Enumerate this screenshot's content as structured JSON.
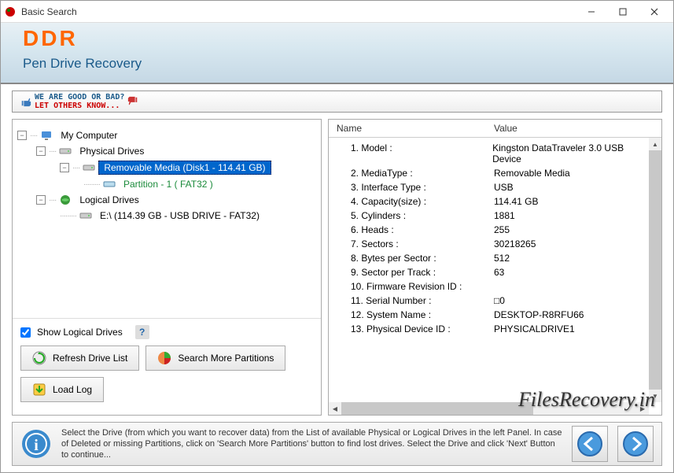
{
  "window": {
    "title": "Basic Search"
  },
  "header": {
    "logo": "DDR",
    "subtitle": "Pen Drive Recovery"
  },
  "feedback": {
    "line1": "WE ARE GOOD OR BAD?",
    "line2": "LET OTHERS KNOW..."
  },
  "tree": {
    "root": "My Computer",
    "physical": "Physical Drives",
    "removable": "Removable Media (Disk1 - 114.41 GB)",
    "partition": "Partition - 1 ( FAT32 )",
    "logical": "Logical Drives",
    "logical_drive": "E:\\ (114.39 GB - USB DRIVE - FAT32)"
  },
  "controls": {
    "show_logical": "Show Logical Drives",
    "refresh": "Refresh Drive List",
    "search_more": "Search More Partitions",
    "load_log": "Load Log"
  },
  "props": {
    "header_name": "Name",
    "header_value": "Value",
    "rows": [
      {
        "n": "1. Model :",
        "v": "Kingston DataTraveler 3.0 USB Device"
      },
      {
        "n": "2. MediaType :",
        "v": "Removable Media"
      },
      {
        "n": "3. Interface Type :",
        "v": "USB"
      },
      {
        "n": "4. Capacity(size) :",
        "v": "114.41 GB"
      },
      {
        "n": "5. Cylinders :",
        "v": "1881"
      },
      {
        "n": "6. Heads :",
        "v": "255"
      },
      {
        "n": "7. Sectors :",
        "v": "30218265"
      },
      {
        "n": "8. Bytes per Sector :",
        "v": "512"
      },
      {
        "n": "9. Sector per Track :",
        "v": "63"
      },
      {
        "n": "10. Firmware Revision ID :",
        "v": ""
      },
      {
        "n": "11. Serial Number :",
        "v": "□0"
      },
      {
        "n": "12. System Name :",
        "v": "DESKTOP-R8RFU66"
      },
      {
        "n": "13. Physical Device ID :",
        "v": "PHYSICALDRIVE1"
      }
    ]
  },
  "watermark": "FilesRecovery.in",
  "hint": "Select the Drive (from which you want to recover data) from the List of available Physical or Logical Drives in the left Panel. In case of Deleted or missing Partitions, click on 'Search More Partitions' button to find lost drives. Select the Drive and click 'Next' Button to continue..."
}
